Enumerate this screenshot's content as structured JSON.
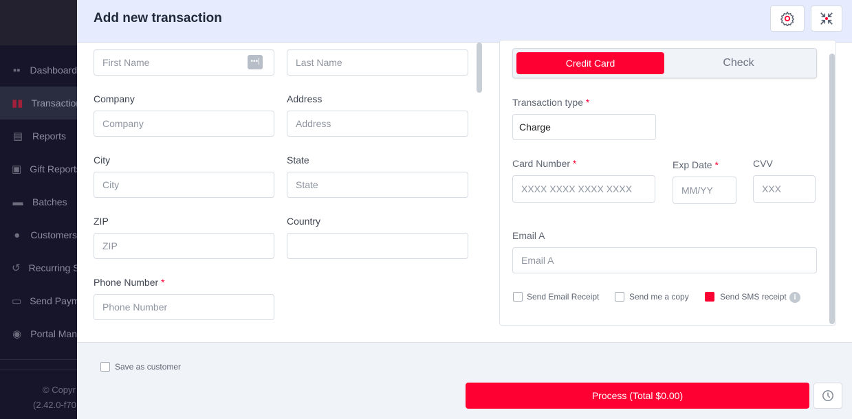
{
  "sidebar": {
    "items": [
      {
        "label": "Dashboard",
        "icon": "grid-icon"
      },
      {
        "label": "Transactions",
        "icon": "receipt-icon",
        "active": true
      },
      {
        "label": "Reports",
        "icon": "list-icon"
      },
      {
        "label": "Gift Reports",
        "icon": "gift-icon"
      },
      {
        "label": "Batches",
        "icon": "wallet-icon"
      },
      {
        "label": "Customers",
        "icon": "users-icon"
      },
      {
        "label": "Recurring S",
        "icon": "recurring-icon"
      },
      {
        "label": "Send Paym",
        "icon": "card-icon"
      },
      {
        "label": "Portal Man",
        "icon": "portal-icon"
      }
    ],
    "copyright": "© Copyr",
    "version": "(2.42.0-f70"
  },
  "header": {
    "title": "Add new transaction"
  },
  "form": {
    "first_name": {
      "placeholder": "First Name"
    },
    "last_name": {
      "placeholder": "Last Name"
    },
    "company": {
      "label": "Company",
      "placeholder": "Company"
    },
    "address": {
      "label": "Address",
      "placeholder": "Address"
    },
    "city": {
      "label": "City",
      "placeholder": "City"
    },
    "state": {
      "label": "State",
      "placeholder": "State"
    },
    "zip": {
      "label": "ZIP",
      "placeholder": "ZIP"
    },
    "country": {
      "label": "Country",
      "value": ""
    },
    "phone": {
      "label": "Phone Number",
      "placeholder": "Phone Number",
      "required": "*"
    }
  },
  "payment": {
    "tabs": [
      {
        "label": "Credit Card",
        "active": true
      },
      {
        "label": "Check"
      }
    ],
    "transaction_type": {
      "label": "Transaction type",
      "value": "Charge",
      "required": "*"
    },
    "card_number": {
      "label": "Card Number",
      "placeholder": "XXXX XXXX XXXX XXXX",
      "required": "*"
    },
    "exp_date": {
      "label": "Exp Date",
      "placeholder": "MM/YY",
      "required": "*"
    },
    "cvv": {
      "label": "CVV",
      "placeholder": "XXX"
    },
    "email": {
      "label": "Email A",
      "placeholder": "Email A"
    },
    "checkboxes": [
      {
        "label": "Send Email Receipt",
        "checked": false
      },
      {
        "label": "Send me a copy",
        "checked": false
      },
      {
        "label": "Send SMS receipt",
        "checked": true
      }
    ]
  },
  "footer": {
    "save_customer": "Save as customer",
    "process": "Process (Total $0.00)"
  },
  "colors": {
    "accent": "#ff0033",
    "sidebar": "#17152a",
    "header": "#e6ecfd"
  }
}
